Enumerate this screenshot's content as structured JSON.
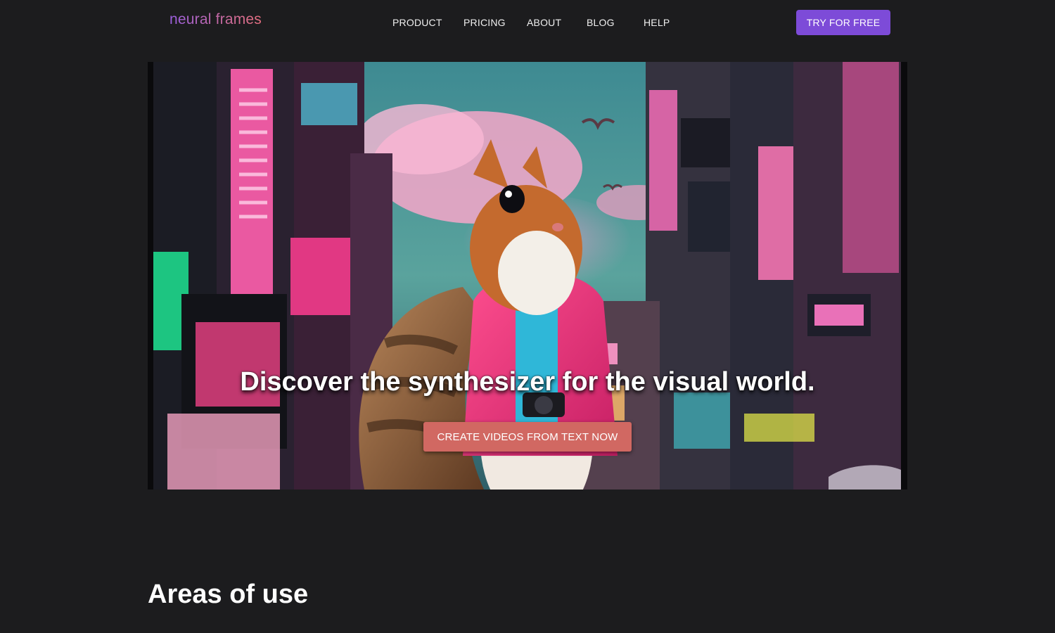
{
  "header": {
    "logo": "neural frames",
    "nav": [
      "PRODUCT",
      "PRICING",
      "ABOUT",
      "BLOG",
      "HELP"
    ],
    "cta_label": "TRY FOR FREE"
  },
  "hero": {
    "image": "neon-city-squirrel-illustration",
    "title": "Discover the synthesizer for the visual world.",
    "cta_label": "CREATE VIDEOS FROM TEXT NOW"
  },
  "sections": {
    "areas_title": "Areas of use"
  },
  "colors": {
    "background": "#1c1c1e",
    "accent_purple": "#7d4bd8",
    "hero_cta": "#d16862"
  }
}
